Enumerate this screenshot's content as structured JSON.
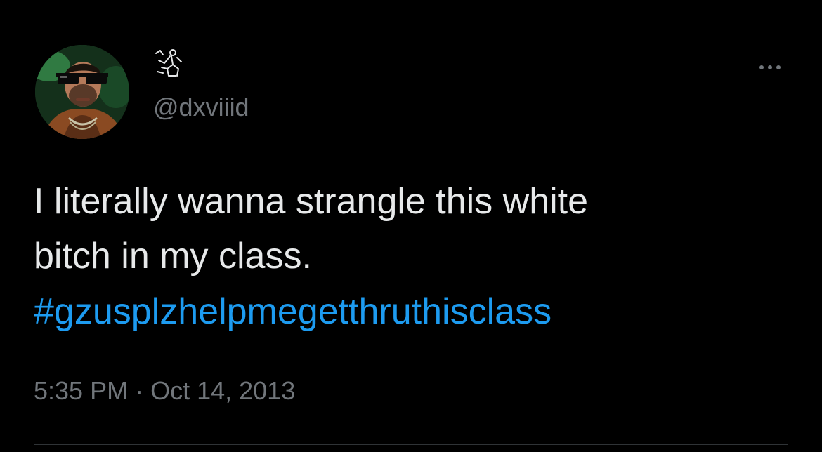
{
  "tweet": {
    "handle": "@dxviiid",
    "text": "I literally wanna strangle this white\nbitch in my class.",
    "hashtag": "#gzusplzhelpmegetthruthisclass",
    "time": "5:35 PM",
    "separator": " · ",
    "date": "Oct 14, 2013"
  },
  "icons": {
    "more": "more-horizontal-icon",
    "display_name_glyph": "kneeling-figure-glyph"
  },
  "colors": {
    "background": "#000000",
    "text": "#e7e9ea",
    "secondary": "#71767b",
    "link": "#1d9bf0",
    "divider": "#2f3336"
  }
}
